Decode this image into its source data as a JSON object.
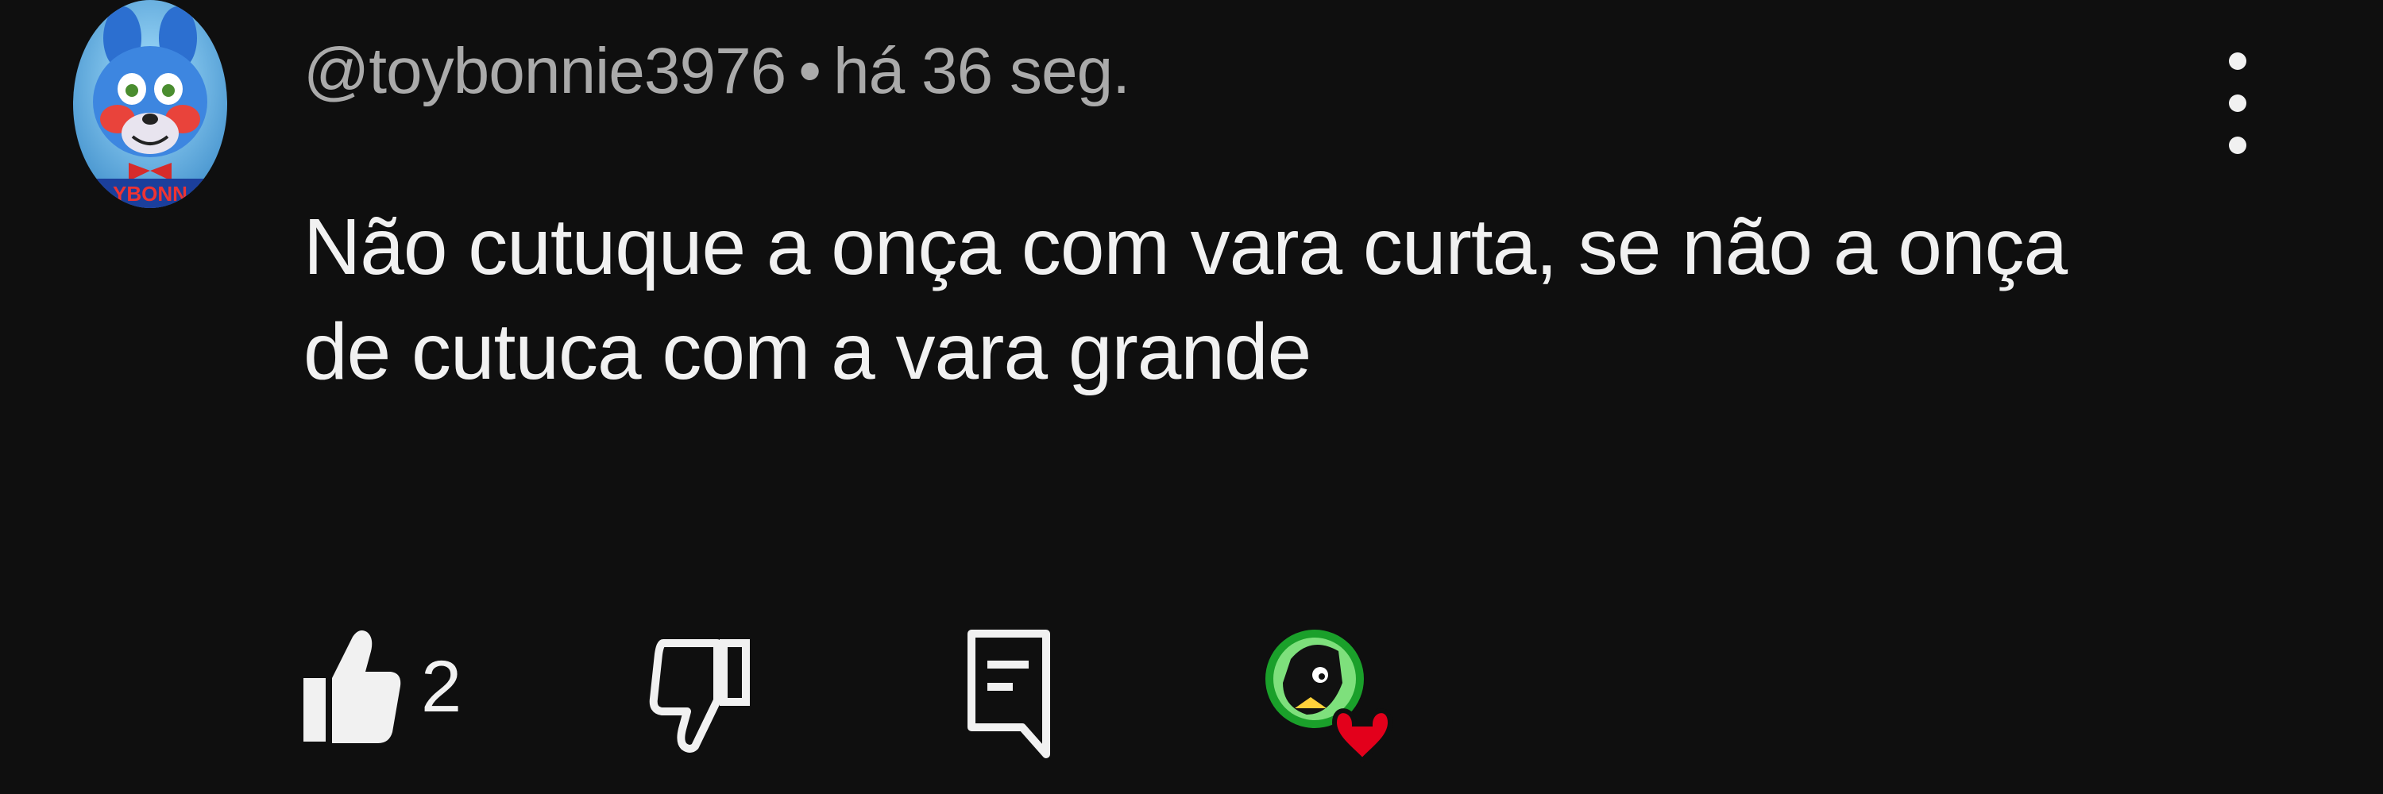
{
  "comment": {
    "author": "@toybonnie3976",
    "separator": "•",
    "timestamp": "há 36 seg.",
    "text": "Não cutuque a onça com vara curta, se não a onça de cutuca com a vara grande",
    "avatar_text": "YBONN"
  },
  "actions": {
    "like_count": "2"
  },
  "icons": {
    "like": "thumbs-up-icon",
    "dislike": "thumbs-down-icon",
    "reply": "reply-icon",
    "more": "more-vert-icon",
    "creator_heart": "creator-heart-icon"
  },
  "colors": {
    "background": "#0f0f0f",
    "text": "#f1f1f1",
    "meta_text": "#aaaaaa",
    "heart": "#e3001b"
  }
}
